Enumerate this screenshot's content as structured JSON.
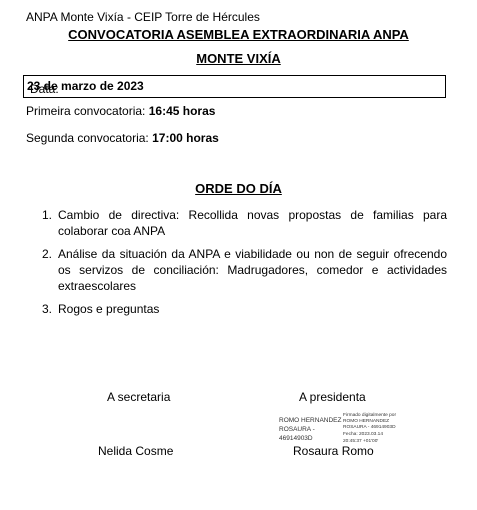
{
  "header": {
    "org_line": "ANPA Monte  Vixía - CEIP Torre de Hércules"
  },
  "title": {
    "line1": "CONVOCATORIA ASEMBLEA EXTRAORDINARIA ANPA",
    "line2": "MONTE VIXÍA"
  },
  "date": {
    "label": "Data: ",
    "value": "23 de marzo de 2023"
  },
  "calls": [
    {
      "label": "Primeira convocatoria: ",
      "time": "16:45 horas"
    },
    {
      "label": "Segunda convocatoria: ",
      "time": "17:00 horas"
    }
  ],
  "agenda": {
    "heading": "ORDE DO DÍA",
    "items": [
      {
        "num": "1.",
        "text": "Cambio de directiva: Recollida novas propostas de familias para colaborar coa ANPA"
      },
      {
        "num": "2.",
        "text": "Análise da situación da ANPA e viabilidade ou non de seguir ofrecendo os servizos de conciliación: Madrugadores, comedor e actividades extraescolares"
      },
      {
        "num": "3.",
        "text": "Rogos e preguntas"
      }
    ]
  },
  "signatures": {
    "secretary_role": "A secretaria",
    "president_role": "A presidenta",
    "secretary_name": "Nelida Cosme",
    "president_name": "Rosaura Romo",
    "digital_sig_left": [
      "ROMO HERNANDEZ",
      "ROSAURA -",
      "46914903D"
    ],
    "digital_sig_right": [
      "Firmado digitalmente por",
      "ROMO HERNANDEZ",
      "ROSAURA - 46914903D",
      "Fecha: 2023.03.14",
      "20:45:37 +01'00'"
    ]
  }
}
